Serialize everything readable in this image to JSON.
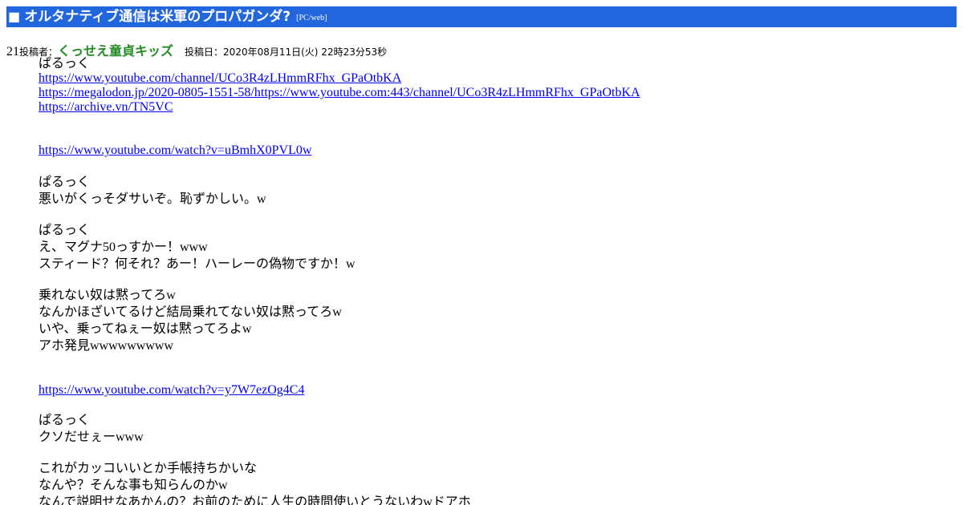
{
  "thread": {
    "square": "■",
    "title": "オルタナティブ通信は米軍のプロパガンダ?",
    "tag": "[PC/web]"
  },
  "post": {
    "number": "21",
    "author_label": "投稿者：",
    "author": "くっせえ童貞キッズ",
    "date_label": "投稿日：",
    "date": "2020年08月11日(火) 22時23分53秒"
  },
  "body": {
    "block1": {
      "name": "ぱるっく",
      "links": [
        "https://www.youtube.com/channel/UCo3R4zLHmmRFhx_GPaOtbKA",
        "https://megalodon.jp/2020-0805-1551-58/https://www.youtube.com:443/channel/UCo3R4zLHmmRFhx_GPaOtbKA",
        "https://archive.vn/TN5VC"
      ]
    },
    "video1": "https://www.youtube.com/watch?v=uBmhX0PVL0w",
    "comment1": [
      "ぱるっく",
      "悪いがくっそダサいぞ。恥ずかしい。w"
    ],
    "comment2": [
      "ぱるっく",
      "え、マグナ50っすかー！www",
      "スティード？何それ？あー！ハーレーの偽物ですか！w"
    ],
    "comment3": [
      "乗れない奴は黙ってろw",
      "なんかほざいてるけど結局乗れてない奴は黙ってろw",
      "いや、乗ってねぇー奴は黙ってろよw",
      "アホ発見wwwwwwwww"
    ],
    "video2": "https://www.youtube.com/watch?v=y7W7ezOg4C4",
    "comment4": [
      "ぱるっく",
      "クソだせぇーwww"
    ],
    "comment5": [
      "これがカッコいいとか手帳持ちかいな",
      "なんや？そんな事も知らんのかw",
      "なんで説明せなあかんの？お前のために人生の時間使いとうないわwドアホ"
    ]
  }
}
